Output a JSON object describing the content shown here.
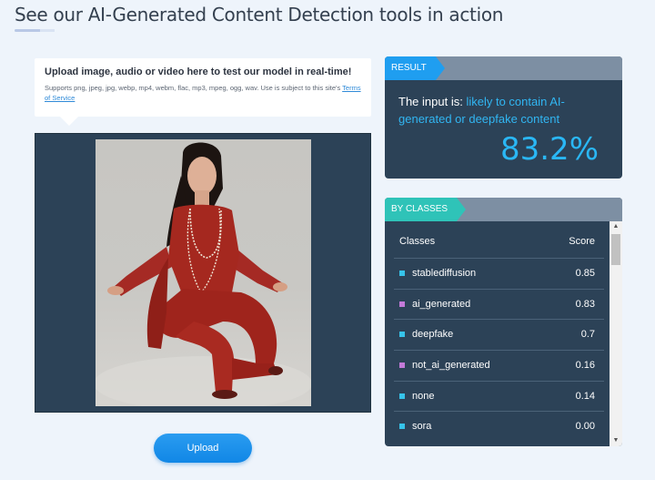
{
  "page": {
    "title": "See our AI-Generated Content Detection tools in action"
  },
  "upload": {
    "title": "Upload image, audio or video here to test our model in real-time!",
    "supports_text": "Supports png, jpeg, jpg, webp, mp4, webm, flac, mp3, mpeg, ogg, wav. Use is subject to this site's",
    "terms_link": "Terms of Service",
    "button_label": "Upload"
  },
  "result": {
    "tag": "RESULT",
    "prefix": "The input is:",
    "verdict": "likely to contain AI-generated or deepfake content",
    "score": "83.2%"
  },
  "classes": {
    "tag": "BY CLASSES",
    "header_class": "Classes",
    "header_score": "Score",
    "rows": [
      {
        "name": "stablediffusion",
        "score": "0.85",
        "color": "#36c3ea"
      },
      {
        "name": "ai_generated",
        "score": "0.83",
        "color": "#c37ad9"
      },
      {
        "name": "deepfake",
        "score": "0.7",
        "color": "#36c3ea"
      },
      {
        "name": "not_ai_generated",
        "score": "0.16",
        "color": "#c37ad9"
      },
      {
        "name": "none",
        "score": "0.14",
        "color": "#36c3ea"
      },
      {
        "name": "sora",
        "score": "0.00",
        "color": "#36c3ea"
      }
    ]
  },
  "colors": {
    "accent": "#1f9ef0",
    "panel": "#2c4257",
    "classes_tag": "#2fc3b8"
  }
}
